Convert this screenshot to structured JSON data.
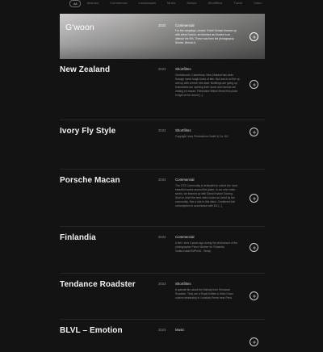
{
  "filters": [
    "All",
    "Abstract",
    "Commercial",
    "Landscapes",
    "Music",
    "Nature",
    "Shortfilms",
    "Travel",
    "Video"
  ],
  "active_filter": "All",
  "projects": [
    {
      "title": "G'woon",
      "year": "2023",
      "category": "Commercial",
      "description": "For the campaign, creator Tronte Schaar teamed up with client Gwoon, art directed as Nordes in an attempt the 90s. These was then the photography. Stories. Behind it.",
      "featured": true
    },
    {
      "title": "New Zealand",
      "year": "2023",
      "category": "Shortfilms",
      "description": "Christchurch, Canterbury. New Zealand has been through some tough times of late. But now is on the up and up with a fresh new start. Buildings are going up, businesses are opening their doors and tourists are visiting en masse. Filmmaker Mikkel filmed this place in light of the recent [...]",
      "featured": false
    },
    {
      "title": "Ivory Fly Style",
      "year": "2024",
      "category": "Shortfilms",
      "description": "Copyright Ivory Productions GmbH & Co. KG",
      "featured": false
    },
    {
      "title": "Porsche Macan",
      "year": "2024",
      "category": "Commercial",
      "description": "The GTS Community is dedicated to collect the most beautiful routes around the globe. In our new video series, we teamed up with David Knauer Touring. Such to drive the best rated routes as voted by the community. See a ride in this video. Combined fuel consumption in accordance with EU [...]",
      "featured": false
    },
    {
      "title": "Finlandia",
      "year": "2024",
      "category": "Commercial",
      "description": "A film I shot 4 years ago during the photoshoot of the photographer Pierre Winther for Finlandia Vodka.Insta/VIMPreM - Vendy",
      "featured": false
    },
    {
      "title": "Tendance Roadster",
      "year": "2023",
      "category": "Shortfilms",
      "description": "A special film about the Melody from Tendance Roadster. They are a Royal Enfield & Moto Guzzi custom dealership in Levallois-Perret near Paris.",
      "featured": false
    },
    {
      "title": "BLVL – Emotion",
      "year": "2023",
      "category": "Music",
      "description": "",
      "featured": false
    }
  ],
  "colors": {
    "background": "#131313",
    "text": "#f2f2f2",
    "muted": "#8d8d8d",
    "divider": "#262626"
  },
  "icons": {
    "expand": "plus-circle-icon"
  }
}
